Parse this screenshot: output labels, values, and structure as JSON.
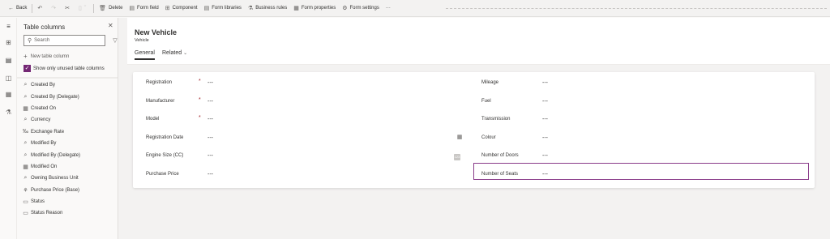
{
  "toolbar": {
    "back_label": "Back",
    "delete_label": "Delete",
    "form_field_label": "Form field",
    "component_label": "Component",
    "form_libraries_label": "Form libraries",
    "business_rules_label": "Business rules",
    "form_properties_label": "Form properties",
    "form_settings_label": "Form settings",
    "more_label": "···"
  },
  "panel": {
    "title": "Table columns",
    "search_placeholder": "Search",
    "new_column_label": "New table column",
    "show_unused_label": "Show only unused table columns",
    "columns": [
      {
        "label": "Created By",
        "icon": "lookup-icon"
      },
      {
        "label": "Created By (Delegate)",
        "icon": "lookup-icon"
      },
      {
        "label": "Created On",
        "icon": "calendar-icon"
      },
      {
        "label": "Currency",
        "icon": "lookup-icon"
      },
      {
        "label": "Exchange Rate",
        "icon": "decimal-icon"
      },
      {
        "label": "Modified By",
        "icon": "lookup-icon"
      },
      {
        "label": "Modified By (Delegate)",
        "icon": "lookup-icon"
      },
      {
        "label": "Modified On",
        "icon": "calendar-icon"
      },
      {
        "label": "Owning Business Unit",
        "icon": "lookup-icon"
      },
      {
        "label": "Purchase Price (Base)",
        "icon": "currency-icon"
      },
      {
        "label": "Status",
        "icon": "option-set-icon"
      },
      {
        "label": "Status Reason",
        "icon": "option-set-icon"
      }
    ]
  },
  "form": {
    "title": "New Vehicle",
    "subtitle": "Vehicle",
    "tabs": {
      "general": "General",
      "related": "Related"
    },
    "left_fields": [
      {
        "label": "Registration",
        "value": "---",
        "required": "*"
      },
      {
        "label": "Manufacturer",
        "value": "---",
        "required": "*"
      },
      {
        "label": "Model",
        "value": "---",
        "required": "*"
      },
      {
        "label": "Registration Date",
        "value": "---"
      },
      {
        "label": "Engine Size (CC)",
        "value": "---"
      },
      {
        "label": "Purchase Price",
        "value": "---"
      }
    ],
    "right_fields": [
      {
        "label": "Mileage",
        "value": "---"
      },
      {
        "label": "Fuel",
        "value": "---"
      },
      {
        "label": "Transmission",
        "value": "---"
      },
      {
        "label": "Colour",
        "value": "---"
      },
      {
        "label": "Number of Doors",
        "value": "---"
      },
      {
        "label": "Number of Seats",
        "value": "---"
      }
    ]
  },
  "colors": {
    "accent": "#742774",
    "selected_border": "#8a3c8a",
    "required": "#a4262c"
  }
}
